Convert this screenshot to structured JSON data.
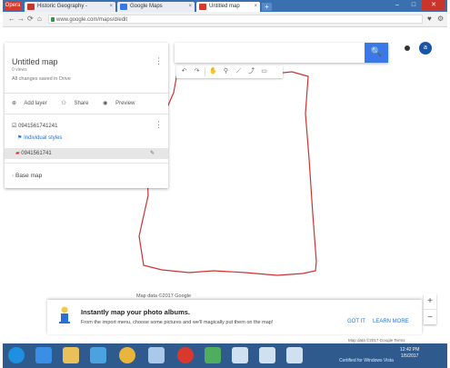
{
  "browser": {
    "logo": "Opera",
    "tabs": [
      {
        "label": "Historic Geography - ",
        "active": false,
        "color": "#c0392b"
      },
      {
        "label": "Google Maps",
        "active": false,
        "color": "#3b78e7"
      },
      {
        "label": "Untitled map",
        "active": true,
        "color": "#d9382c"
      }
    ],
    "new_tab": "+",
    "window_controls": {
      "minimize": "–",
      "maximize": "□",
      "close": "✕"
    },
    "url": "www.google.com/maps/d/edit",
    "nav": {
      "back": "←",
      "forward": "→",
      "reload": "⟳",
      "home": "⌂",
      "heart": "♥",
      "settings": "⚙"
    }
  },
  "panel": {
    "title": "Untitled map",
    "views": "0 views",
    "saved_status": "All changes saved in Drive",
    "actions": [
      {
        "icon": "add-layer-icon",
        "glyph": "⊕",
        "label": "Add layer"
      },
      {
        "icon": "share-icon",
        "glyph": "⚇",
        "label": "Share"
      },
      {
        "icon": "preview-icon",
        "glyph": "◉",
        "label": "Preview"
      }
    ],
    "layer_name": "0941561741241",
    "layer_style": "Individual styles",
    "feature_name": "0941561741",
    "base_map": "Base map",
    "kebab": "⋮"
  },
  "search": {
    "placeholder": "",
    "button": "🔍"
  },
  "toolbar": {
    "tools": [
      {
        "name": "undo-icon",
        "glyph": "↶"
      },
      {
        "name": "redo-icon",
        "glyph": "↷"
      },
      {
        "name": "hand-icon",
        "glyph": "✋"
      },
      {
        "name": "marker-icon",
        "glyph": "⚲"
      },
      {
        "name": "draw-line-icon",
        "glyph": "⟋"
      },
      {
        "name": "directions-icon",
        "glyph": "⤴"
      },
      {
        "name": "ruler-icon",
        "glyph": "▭"
      }
    ]
  },
  "account_initial": "a",
  "map_attribution": "Map data ©2017 Google",
  "zoom": {
    "in": "+",
    "out": "−"
  },
  "promo": {
    "title": "Instantly map your photo albums.",
    "description": "From the import menu, choose some pictures and we'll magically put them on the map!",
    "got_it": "GOT IT",
    "learn_more": "LEARN MORE"
  },
  "footer": "Map data ©2017 Google  Terms",
  "taskbar": {
    "icons": [
      {
        "name": "start-icon",
        "color": "#1f8fe0"
      },
      {
        "name": "ie-icon",
        "color": "#3a8ee6"
      },
      {
        "name": "explorer-icon",
        "color": "#e8c15a"
      },
      {
        "name": "media-icon",
        "color": "#4aa3df"
      },
      {
        "name": "chrome-icon",
        "color": "#e9b53c"
      },
      {
        "name": "network-icon",
        "color": "#a9c8ea"
      },
      {
        "name": "opera-icon",
        "color": "#d9382c"
      },
      {
        "name": "security-icon",
        "color": "#4fae5d"
      },
      {
        "name": "app-icon-1",
        "color": "#cfe0f1"
      },
      {
        "name": "app-icon-2",
        "color": "#cfe0f1"
      },
      {
        "name": "app-icon-3",
        "color": "#cfe0f1"
      }
    ],
    "tray_text": "Certified for Windows Vista",
    "clock_time": "12:42 PM",
    "clock_date": "1/5/2017"
  },
  "colors": {
    "accent": "#3b78e7",
    "drawn_shape": "#cc3333",
    "taskbar": "#2e5a8e"
  }
}
